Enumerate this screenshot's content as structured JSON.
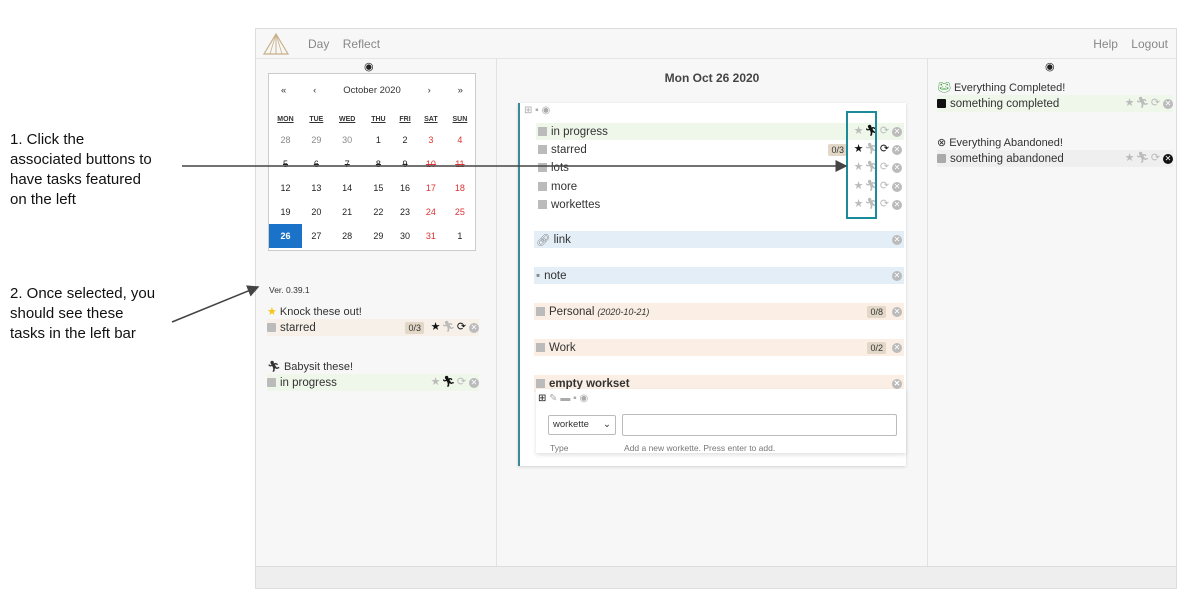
{
  "annotations": {
    "step1": "1. Click the associated buttons to have tasks featured on the left",
    "step2": "2. Once selected, you should see these tasks in the left bar"
  },
  "nav": {
    "day": "Day",
    "reflect": "Reflect",
    "help": "Help",
    "logout": "Logout"
  },
  "calendar": {
    "month": "October 2020",
    "prev_year": "«",
    "prev": "‹",
    "next": "›",
    "next_year": "»",
    "weekdays": [
      "MON",
      "TUE",
      "WED",
      "THU",
      "FRI",
      "SAT",
      "SUN"
    ],
    "weeks": [
      [
        "28",
        "29",
        "30",
        "1",
        "2",
        "3",
        "4"
      ],
      [
        "5",
        "6",
        "7",
        "8",
        "9",
        "10",
        "11"
      ],
      [
        "12",
        "13",
        "14",
        "15",
        "16",
        "17",
        "18"
      ],
      [
        "19",
        "20",
        "21",
        "22",
        "23",
        "24",
        "25"
      ],
      [
        "26",
        "27",
        "28",
        "29",
        "30",
        "31",
        "1"
      ]
    ],
    "selected": "26"
  },
  "version": "Ver. 0.39.1",
  "left": {
    "starred_title": "Knock these out!",
    "starred_task": "starred",
    "starred_badge": "0/3",
    "babysit_title": "Babysit these!",
    "babysit_task": "in progress"
  },
  "middle": {
    "date": "Mon Oct 26 2020",
    "tasks": [
      "in progress",
      "starred",
      "lots",
      "more",
      "workettes"
    ],
    "starred_badge": "0/3",
    "link": "link",
    "note": "note",
    "personal": "Personal",
    "personal_date": "(2020-10-21)",
    "personal_badge": "0/8",
    "work": "Work",
    "work_badge": "0/2",
    "empty": "empty workset",
    "select_value": "workette",
    "type_label": "Type",
    "hint": "Add a new workette. Press enter to add."
  },
  "right": {
    "completed_title": "Everything Completed!",
    "completed_task": "something completed",
    "abandoned_title": "Everything Abandoned!",
    "abandoned_task": "something abandoned"
  },
  "colors": {
    "accent": "#1b8a9a",
    "selected_day": "#1a73c8",
    "weekend": "#d33333"
  }
}
